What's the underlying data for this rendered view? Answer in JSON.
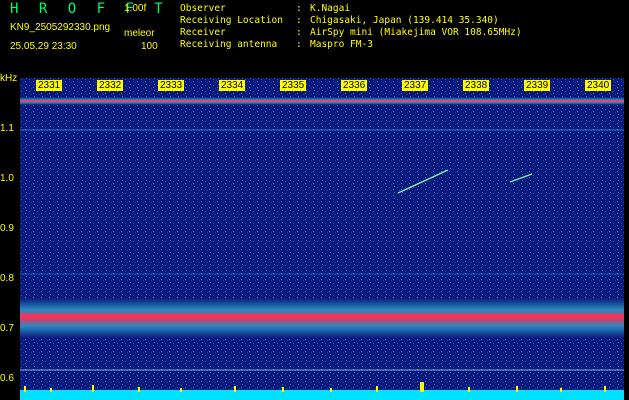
{
  "header": {
    "app_title": "H R O F F T",
    "version": "1.00f",
    "file_name": "KN9_2505292330.png",
    "meteor_label": "meleor",
    "datetime": "25.05.29 23:30",
    "meteor_value": "100"
  },
  "info": [
    {
      "key": "Observer",
      "value": "K.Nagai"
    },
    {
      "key": "Receiving Location",
      "value": "Chigasaki, Japan (139.414 35.340)"
    },
    {
      "key": "Receiver",
      "value": "AirSpy mini (Miakejima VOR 108.65MHz)"
    },
    {
      "key": "Receiving antenna",
      "value": "Maspro FM-3"
    }
  ],
  "axis": {
    "y_unit": "kHz",
    "y_ticks": [
      "1.1",
      "1.0",
      "0.9",
      "0.8",
      "0.7",
      "0.6"
    ],
    "x_ticks": [
      "2331",
      "2332",
      "2333",
      "2334",
      "2335",
      "2336",
      "2337",
      "2338",
      "2339",
      "2340"
    ]
  },
  "colors": {
    "background": "#000000",
    "label": "#ffff00",
    "title": "#00ff66",
    "waterfall_bg": "#0a1a7a",
    "carrier": "#ff3355"
  }
}
